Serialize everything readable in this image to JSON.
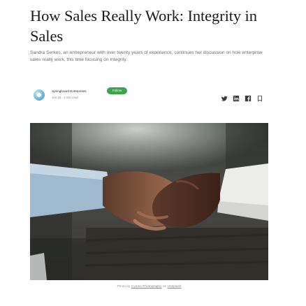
{
  "article": {
    "title": "How Sales Really Work: Integrity in Sales",
    "subtitle": "Sandra Serkes, an entrepreneur with over twenty years of experience, continues her discussion on how enterprise sales really work, this time focusing on Integrity.",
    "author": {
      "name": "Springboard Enterprises",
      "follow_label": "Follow",
      "meta": "Jun 18 · 3 min read"
    },
    "share_icons": [
      "twitter-icon",
      "linkedin-icon",
      "facebook-icon",
      "bookmark-icon"
    ],
    "hero_image": {
      "alt": "Handshake"
    },
    "caption": {
      "prefix": "Photo by",
      "photographer": "Cytonn Photography",
      "on": "on",
      "source": "Unsplash"
    }
  },
  "colors": {
    "title": "#1a1a1a",
    "follow_button": "#3fa34d",
    "meta": "#8a8a8a"
  }
}
